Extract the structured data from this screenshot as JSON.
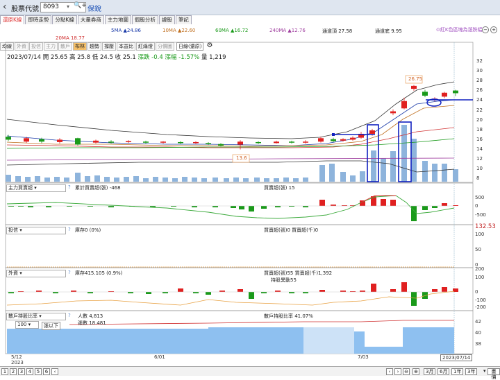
{
  "header": {
    "back_icon": "chevron-left-icon",
    "title": "股票代號",
    "code": "8093",
    "stock_name": "保銳"
  },
  "tabs": [
    "還原K線",
    "即時走勢",
    "分點K線",
    "大量券商",
    "主力地圖",
    "個股分析",
    "證股",
    "筆記"
  ],
  "ma_legend": {
    "ma5": "5MA ▲24.86",
    "ma10": "10MA ▲22.60",
    "ma60": "60MA ▲16.72",
    "ma240": "240MA ▲12.76",
    "ch_top": "通道頂 27.58",
    "ch_bot": "通道底 9.95",
    "ma20": "20MA 18.77",
    "note": "⊙紅K色區塊為漲跌幅"
  },
  "toolbar": {
    "items": [
      "均線",
      "外資",
      "投信",
      "主力",
      "散戶",
      "布林",
      "趨勢",
      "撐壓",
      "本益比",
      "紅綠燈",
      "分價圖"
    ],
    "period": "日線(還原)"
  },
  "quote": {
    "date": "2023/07/14",
    "open": "開 25.65",
    "high": "高 25.8",
    "low": "低 24.5",
    "close": "收 25.1",
    "chg": "漲跌 -0.4",
    "pct": "漲幅 -1.57%",
    "vol": "量 1,219"
  },
  "annotations": {
    "high_tag": "26.75",
    "low_tag": "13.6"
  },
  "price_axis": [
    "32",
    "30",
    "28",
    "26",
    "24",
    "22",
    "20",
    "18",
    "16",
    "14",
    "12",
    "10",
    "8"
  ],
  "panels": {
    "main_force": {
      "select": "主力買賣超",
      "cum": "累計買賣超(張) -468",
      "net": "買賣超(張) 15",
      "axis": [
        "500",
        "0",
        "-500"
      ]
    },
    "trust": {
      "select": "投信",
      "hold": "庫存0 (0%)",
      "net": "買賣超(張)0 買賣超(千)0",
      "axis": [
        "132.53",
        "100",
        "50",
        "0"
      ]
    },
    "foreign": {
      "select": "外資",
      "hold": "庫存415.105 (0.9%)",
      "net": "買賣超(張)55 買賣超(千)1,392",
      "held": "持股異動55",
      "axis": [
        "200",
        "100",
        "0",
        "-100",
        "-200"
      ]
    },
    "retail": {
      "select": "散戶持股比率",
      "count": "人數 4,813",
      "lots": "張數 18.481",
      "ratio": "散戶持股比率 41.07%",
      "filter_val": "100",
      "filter_label": "張以下",
      "axis": [
        "42",
        "40",
        "38"
      ]
    }
  },
  "date_axis": {
    "d1": "5/12",
    "y1": "2023",
    "d2": "6/01",
    "d3": "7/03",
    "end": "2023/07/14"
  },
  "bottom": {
    "pages": [
      "1",
      "2",
      "3",
      "4",
      "5",
      "6"
    ],
    "ranges": [
      "3月",
      "6月",
      "1年",
      "3年"
    ],
    "more": "畫價"
  },
  "colors": {
    "up": "#e02020",
    "down": "#1a9a1a",
    "vol": "#8eb4dc",
    "retail": "#8ec0f0"
  }
}
